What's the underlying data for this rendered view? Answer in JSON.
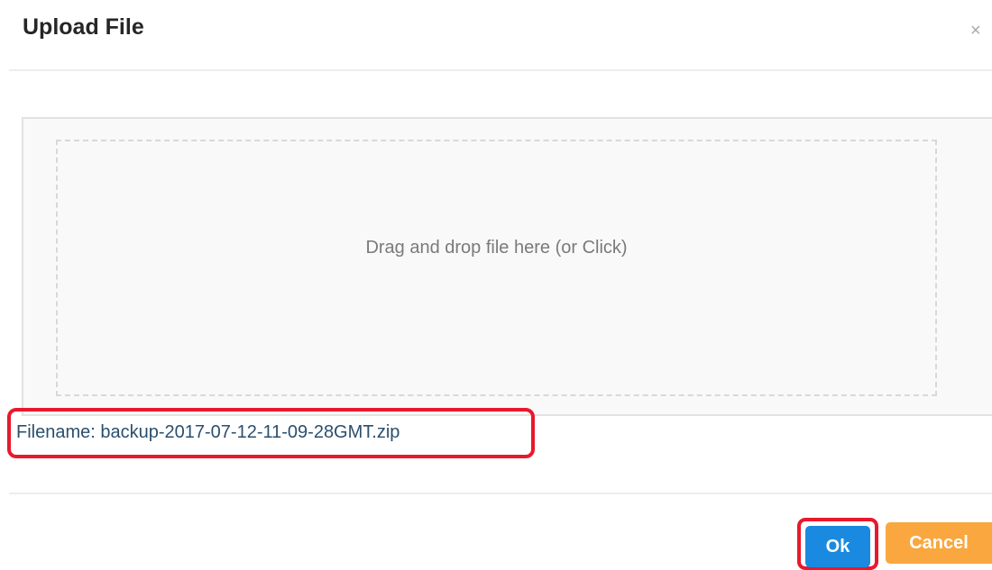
{
  "dialog": {
    "title": "Upload File",
    "close_glyph": "×",
    "close_icon": "close-icon"
  },
  "dropzone": {
    "text": "Drag and drop file here (or Click)"
  },
  "file": {
    "label": "Filename: backup-2017-07-12-11-09-28GMT.zip"
  },
  "footer": {
    "ok_label": "Ok",
    "cancel_label": "Cancel"
  },
  "colors": {
    "ok_button": "#1a8ae0",
    "cancel_button": "#f9a73e",
    "highlight": "#e8192c",
    "filename_text": "#2a4f6e"
  }
}
